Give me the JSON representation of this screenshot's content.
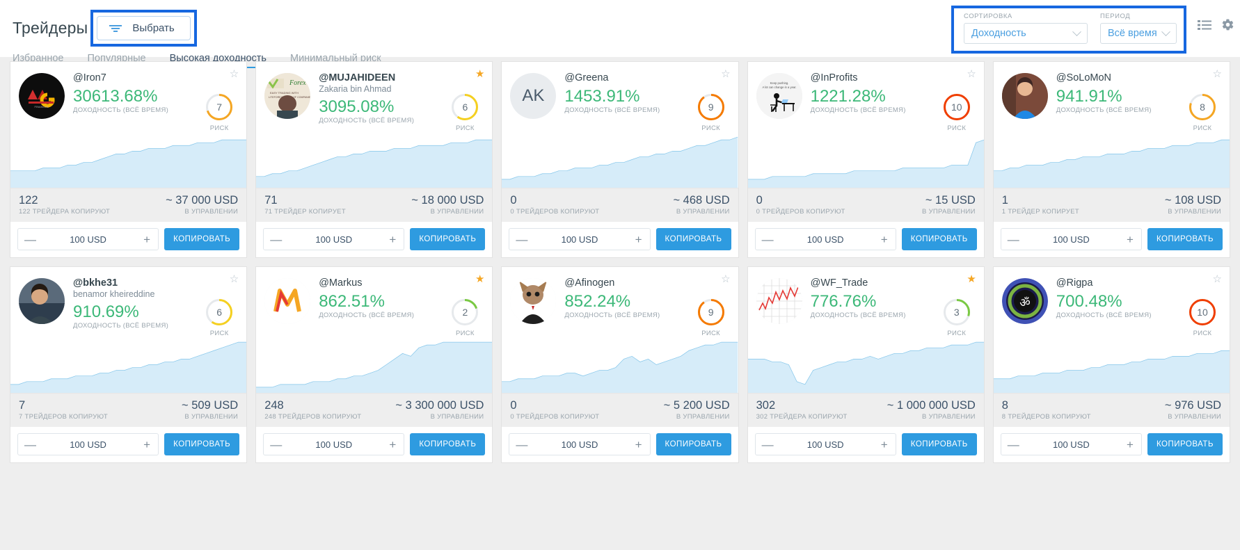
{
  "header": {
    "page_title": "Трейдеры",
    "select_button": "Выбрать",
    "tabs": [
      {
        "label": "Избранное",
        "active": false
      },
      {
        "label": "Популярные",
        "active": false
      },
      {
        "label": "Высокая доходность",
        "active": true
      },
      {
        "label": "Минимальный риск",
        "active": false
      }
    ],
    "sort": {
      "label": "СОРТИРОВКА",
      "value": "Доходность"
    },
    "period": {
      "label": "ПЕРИОД",
      "value": "Всё время"
    },
    "icons": [
      "list-view-icon",
      "gear-icon"
    ],
    "highlight_color": "#1667e0"
  },
  "labels": {
    "profit_label": "ДОХОДНОСТЬ (ВСЁ ВРЕМЯ)",
    "risk_label": "РИСК",
    "aum_label": "В УПРАВЛЕНИИ",
    "copy_button": "КОПИРОВАТЬ",
    "amount_value": "100 USD",
    "minus": "—",
    "plus": "+"
  },
  "colors": {
    "profit_green": "#3cb878",
    "accent_blue": "#2e9be0",
    "risk_low": "#7ac943",
    "risk_mid": "#f5d020",
    "risk_high": "#f5a623",
    "risk_vhigh": "#f57a00",
    "risk_max": "#f03e00"
  },
  "cards": [
    {
      "nick": "@Iron7",
      "realname": "",
      "profit": "30613.68%",
      "risk": 7,
      "risk_color": "#f5a623",
      "favorite": false,
      "copiers_value": "122",
      "copiers_label": "122 ТРЕЙДЕРА КОПИРУЮТ",
      "aum_value": "~ 37 000 USD",
      "avatar_type": "logo-amg",
      "avatar_text": "",
      "spark": [
        14,
        14,
        14,
        14,
        13,
        13,
        13,
        12,
        12,
        11,
        11,
        10,
        9,
        8,
        8,
        7,
        7,
        6,
        6,
        6,
        5,
        5,
        5,
        4,
        4,
        4,
        3,
        3,
        3,
        3
      ]
    },
    {
      "nick": "@MUJAHIDEEN",
      "realname": "Zakaria bin Ahmad",
      "profit": "3095.08%",
      "risk": 6,
      "risk_color": "#f5d020",
      "favorite": true,
      "copiers_value": "71",
      "copiers_label": "71 ТРЕЙДЕР КОПИРУЕТ",
      "aum_value": "~ 18 000 USD",
      "avatar_type": "photo-mujahideen",
      "avatar_text": "",
      "spark": [
        16,
        16,
        15,
        15,
        14,
        14,
        13,
        12,
        11,
        10,
        9,
        9,
        8,
        8,
        7,
        7,
        7,
        6,
        6,
        6,
        5,
        5,
        5,
        5,
        4,
        4,
        4,
        3,
        3,
        3
      ]
    },
    {
      "nick": "@Greena",
      "realname": "",
      "profit": "1453.91%",
      "risk": 9,
      "risk_color": "#f57a00",
      "favorite": false,
      "copiers_value": "0",
      "copiers_label": "0 ТРЕЙДЕРОВ КОПИРУЮТ",
      "aum_value": "~ 468 USD",
      "avatar_type": "initials",
      "avatar_text": "AK",
      "spark": [
        17,
        17,
        16,
        16,
        16,
        15,
        15,
        14,
        14,
        13,
        13,
        13,
        12,
        12,
        11,
        11,
        10,
        9,
        9,
        8,
        8,
        7,
        7,
        6,
        5,
        5,
        4,
        3,
        3,
        2
      ]
    },
    {
      "nick": "@InProfits",
      "realname": "",
      "profit": "1221.28%",
      "risk": 10,
      "risk_color": "#f03e00",
      "favorite": false,
      "copiers_value": "0",
      "copiers_label": "0 ТРЕЙДЕРОВ КОПИРУЮТ",
      "aum_value": "~ 15 USD",
      "avatar_type": "sketch-desk",
      "avatar_text": "",
      "spark": [
        17,
        17,
        17,
        16,
        16,
        16,
        16,
        16,
        15,
        15,
        15,
        15,
        15,
        14,
        14,
        14,
        14,
        14,
        14,
        13,
        13,
        13,
        13,
        13,
        13,
        12,
        12,
        12,
        4,
        3
      ]
    },
    {
      "nick": "@SoLoMoN",
      "realname": "",
      "profit": "941.91%",
      "risk": 8,
      "risk_color": "#f5a623",
      "favorite": false,
      "copiers_value": "1",
      "copiers_label": "1 ТРЕЙДЕР КОПИРУЕТ",
      "aum_value": "~ 108 USD",
      "avatar_type": "photo-solomon",
      "avatar_text": "",
      "spark": [
        14,
        14,
        13,
        13,
        12,
        12,
        12,
        11,
        11,
        10,
        10,
        9,
        9,
        9,
        8,
        8,
        8,
        7,
        7,
        6,
        6,
        6,
        5,
        5,
        5,
        4,
        4,
        4,
        3,
        3
      ]
    },
    {
      "nick": "@bkhe31",
      "realname": "benamor kheireddine",
      "profit": "910.69%",
      "risk": 6,
      "risk_color": "#f5d020",
      "favorite": false,
      "copiers_value": "7",
      "copiers_label": "7 ТРЕЙДЕРОВ КОПИРУЮТ",
      "aum_value": "~ 509 USD",
      "avatar_type": "photo-bkhe",
      "avatar_text": "",
      "spark": [
        17,
        17,
        16,
        16,
        16,
        15,
        15,
        15,
        14,
        14,
        14,
        13,
        13,
        12,
        12,
        11,
        11,
        10,
        10,
        9,
        9,
        8,
        8,
        7,
        6,
        5,
        4,
        3,
        2,
        2
      ]
    },
    {
      "nick": "@Markus",
      "realname": "",
      "profit": "862.51%",
      "risk": 2,
      "risk_color": "#7ac943",
      "favorite": true,
      "copiers_value": "248",
      "copiers_label": "248 ТРЕЙДЕРОВ КОПИРУЮТ",
      "aum_value": "~ 3 300 000 USD",
      "avatar_type": "logo-markus",
      "avatar_text": "",
      "spark": [
        18,
        18,
        18,
        17,
        17,
        17,
        17,
        16,
        16,
        16,
        15,
        15,
        14,
        14,
        13,
        12,
        10,
        8,
        6,
        7,
        4,
        3,
        3,
        2,
        2,
        2,
        2,
        2,
        2,
        2
      ]
    },
    {
      "nick": "@Afinogen",
      "realname": "",
      "profit": "852.24%",
      "risk": 9,
      "risk_color": "#f57a00",
      "favorite": false,
      "copiers_value": "0",
      "copiers_label": "0 ТРЕЙДЕРОВ КОПИРУЮТ",
      "aum_value": "~ 5 200 USD",
      "avatar_type": "photo-afinogen",
      "avatar_text": "",
      "spark": [
        16,
        16,
        15,
        15,
        15,
        14,
        14,
        14,
        13,
        13,
        14,
        13,
        12,
        12,
        11,
        8,
        7,
        9,
        8,
        10,
        9,
        8,
        7,
        5,
        4,
        3,
        3,
        2,
        2,
        2
      ]
    },
    {
      "nick": "@WF_Trade",
      "realname": "",
      "profit": "776.76%",
      "risk": 3,
      "risk_color": "#7ac943",
      "favorite": true,
      "copiers_value": "302",
      "copiers_label": "302 ТРЕЙДЕРА КОПИРУЮТ",
      "aum_value": "~ 1 000 000 USD",
      "avatar_type": "chart-thumb",
      "avatar_text": "",
      "spark": [
        8,
        8,
        8,
        9,
        9,
        10,
        16,
        17,
        12,
        11,
        10,
        9,
        9,
        8,
        8,
        7,
        8,
        7,
        6,
        6,
        5,
        5,
        4,
        4,
        4,
        3,
        3,
        3,
        2,
        2
      ]
    },
    {
      "nick": "@Rigpa",
      "realname": "",
      "profit": "700.48%",
      "risk": 10,
      "risk_color": "#f03e00",
      "favorite": false,
      "copiers_value": "8",
      "copiers_label": "8 ТРЕЙДЕРОВ КОПИРУЮТ",
      "aum_value": "~ 976 USD",
      "avatar_type": "logo-rigpa",
      "avatar_text": "",
      "spark": [
        15,
        15,
        15,
        14,
        14,
        14,
        13,
        13,
        13,
        12,
        12,
        12,
        11,
        11,
        10,
        10,
        10,
        9,
        9,
        8,
        8,
        8,
        7,
        7,
        7,
        6,
        6,
        6,
        5,
        5
      ]
    }
  ]
}
